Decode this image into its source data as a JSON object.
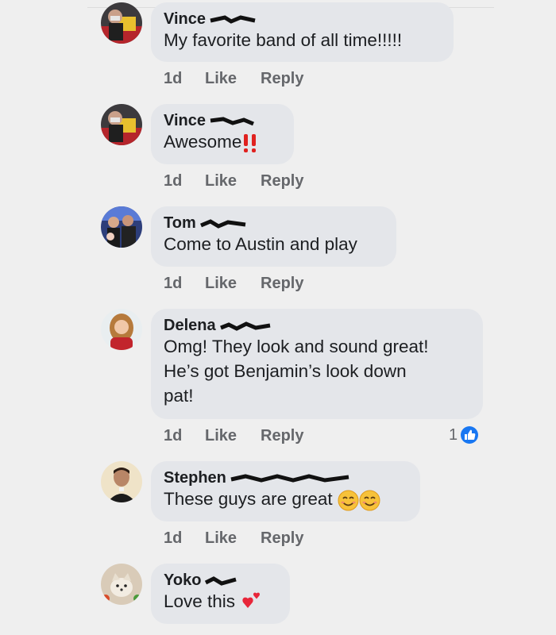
{
  "comments": [
    {
      "name": "Vince",
      "text": "My favorite  band of all time!!!!!",
      "time": "1d",
      "like": "Like",
      "reply": "Reply",
      "avatar_icon": "person-with-flag-avatar"
    },
    {
      "name": "Vince",
      "text": "Awesome",
      "emoji": "double-exclamation-icon",
      "time": "1d",
      "like": "Like",
      "reply": "Reply",
      "avatar_icon": "person-with-flag-avatar"
    },
    {
      "name": "Tom",
      "text": "Come to Austin and play",
      "time": "1d",
      "like": "Like",
      "reply": "Reply",
      "avatar_icon": "group-photo-avatar"
    },
    {
      "name": "Delena",
      "text_lines": [
        "Omg!  They look and sound great!",
        "He’s got Benjamin’s look down",
        "pat!"
      ],
      "time": "1d",
      "like": "Like",
      "reply": "Reply",
      "reaction_count": "1",
      "reaction_icon": "like-thumb-icon",
      "avatar_icon": "woman-portrait-avatar"
    },
    {
      "name": "Stephen",
      "text": "These guys are great",
      "emoji": "smiling-face-icon",
      "time": "1d",
      "like": "Like",
      "reply": "Reply",
      "avatar_icon": "man-portrait-avatar"
    },
    {
      "name": "Yoko",
      "text": "Love this",
      "emoji": "two-hearts-icon",
      "avatar_icon": "dog-photo-avatar"
    }
  ],
  "colors": {
    "background": "#efefef",
    "bubble": "#e4e6ea",
    "name_text": "#1c1e21",
    "meta_text": "#65676b",
    "like_blue": "#1877f2",
    "exclaim_red": "#e0211f",
    "heart_red": "#e8263a"
  }
}
